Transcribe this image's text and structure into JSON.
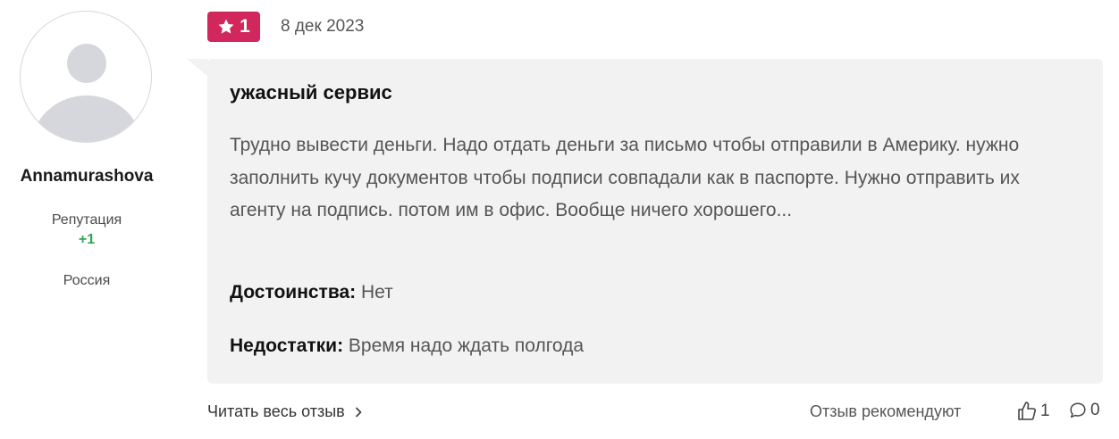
{
  "user": {
    "name": "Annamurashova",
    "reputation_label": "Репутация",
    "reputation_value": "+1",
    "country": "Россия",
    "avatar_icon": "user-avatar-placeholder-icon"
  },
  "review": {
    "rating": "1",
    "rating_color": "#d1275d",
    "date": "8 дек 2023",
    "title": "ужасный сервис",
    "text": "Трудно вывести деньги. Надо отдать деньги за письмо чтобы отправили в Америку. нужно заполнить кучу документов чтобы подписи совпадали как в паспорте. Нужно отправить их агенту на подпись. потом им в офис. Вообще ничего хорошего...",
    "pros_label": "Достоинства:",
    "pros_value": "Нет",
    "cons_label": "Недостатки:",
    "cons_value": "Время надо ждать полгода"
  },
  "footer": {
    "read_more": "Читать весь отзыв",
    "recommend_label": "Отзыв рекомендуют",
    "likes": "1",
    "comments": "0"
  }
}
